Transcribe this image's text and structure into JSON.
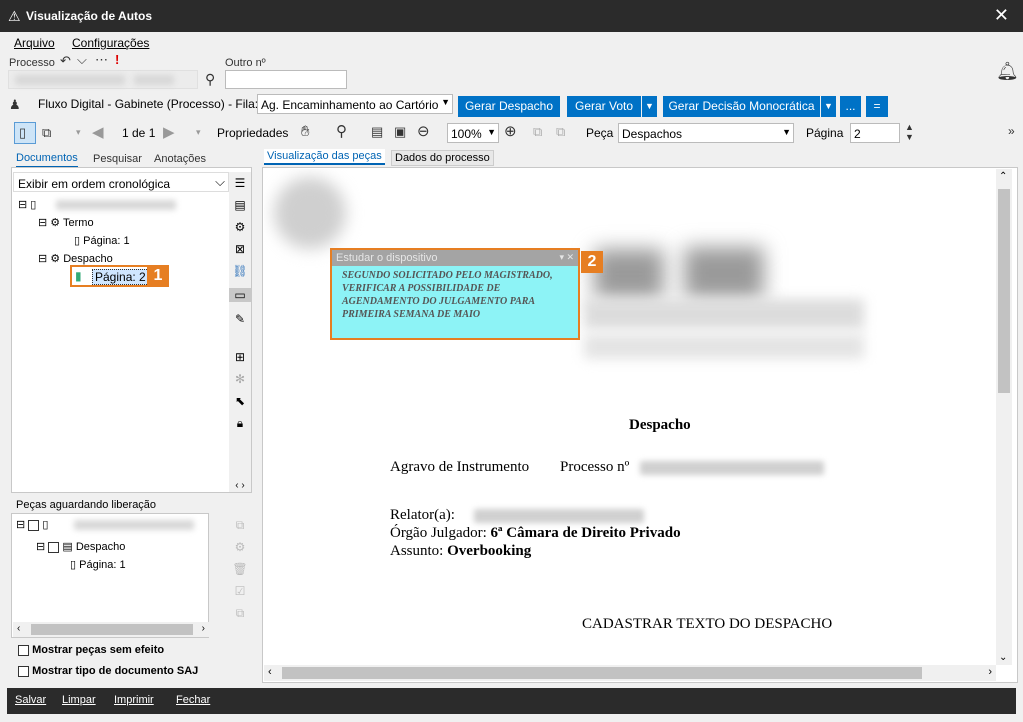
{
  "title": "Visualização de Autos",
  "menu": {
    "arquivo": "Arquivo",
    "config": "Configurações"
  },
  "fields": {
    "processo": "Processo",
    "outro": "Outro nº"
  },
  "fluxo": "Fluxo Digital - Gabinete (Processo) - Fila:",
  "fila": "Ag. Encaminhamento ao Cartório",
  "buttons": {
    "despacho": "Gerar Despacho",
    "voto": "Gerar Voto",
    "decisao": "Gerar Decisão Monocrática",
    "more": "...",
    "filter": "="
  },
  "toolbar": {
    "page_of": "1 de 1",
    "propriedades": "Propriedades",
    "zoom": "100%",
    "peca_label": "Peça",
    "peca_value": "Despachos",
    "pagina_label": "Página",
    "pagina_value": "2"
  },
  "left_tabs": [
    "Documentos",
    "Pesquisar",
    "Anotações"
  ],
  "order": "Exibir em ordem cronológica",
  "tree": {
    "termo": "Termo",
    "pagina1": "Página: 1",
    "despacho": "Despacho",
    "pagina2": "Página: 2"
  },
  "aguardando": {
    "title": "Peças aguardando liberação",
    "despacho": "Despacho",
    "pagina1": "Página: 1"
  },
  "checks": {
    "sem_efeito": "Mostrar peças sem efeito",
    "tipo_doc": "Mostrar tipo de documento SAJ"
  },
  "right_tabs": [
    "Visualização das peças",
    "Dados do processo"
  ],
  "note": {
    "header": "Estudar o dispositivo",
    "text": "SEGUNDO SOLICITADO PELO MAGISTRADO, VERIFICAR A POSSIBILIDADE DE AGENDAMENTO DO JULGAMENTO PARA PRIMEIRA SEMANA DE MAIO"
  },
  "badges": {
    "one": "1",
    "two": "2"
  },
  "doc": {
    "heading": "Despacho",
    "agravo": "Agravo de Instrumento",
    "processo": "Processo nº",
    "relator": "Relator(a):",
    "orgao_label": "Órgão Julgador:",
    "orgao": "6ª Câmara de Direito Privado",
    "assunto_label": "Assunto:",
    "assunto": "Overbooking",
    "cadastrar": "CADASTRAR TEXTO DO DESPACHO"
  },
  "footer": {
    "salvar": "Salvar",
    "limpar": "Limpar",
    "imprimir": "Imprimir",
    "fechar": "Fechar"
  }
}
